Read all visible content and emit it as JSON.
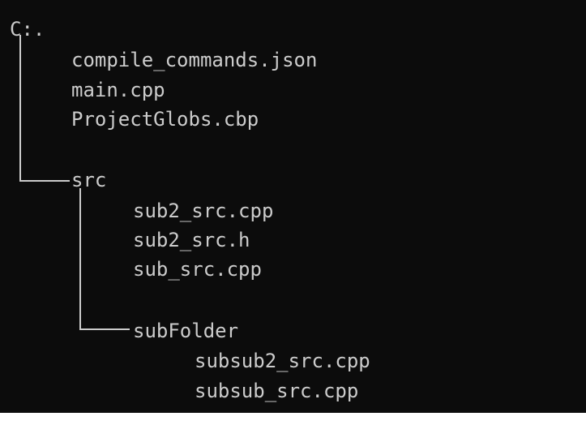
{
  "terminal": {
    "root": "C:.",
    "root_files": [
      "compile_commands.json",
      "main.cpp",
      "ProjectGlobs.cbp"
    ],
    "src_folder": "src",
    "src_files": [
      "sub2_src.cpp",
      "sub2_src.h",
      "sub_src.cpp"
    ],
    "subfolder": "subFolder",
    "subfolder_files": [
      "subsub2_src.cpp",
      "subsub_src.cpp"
    ]
  }
}
